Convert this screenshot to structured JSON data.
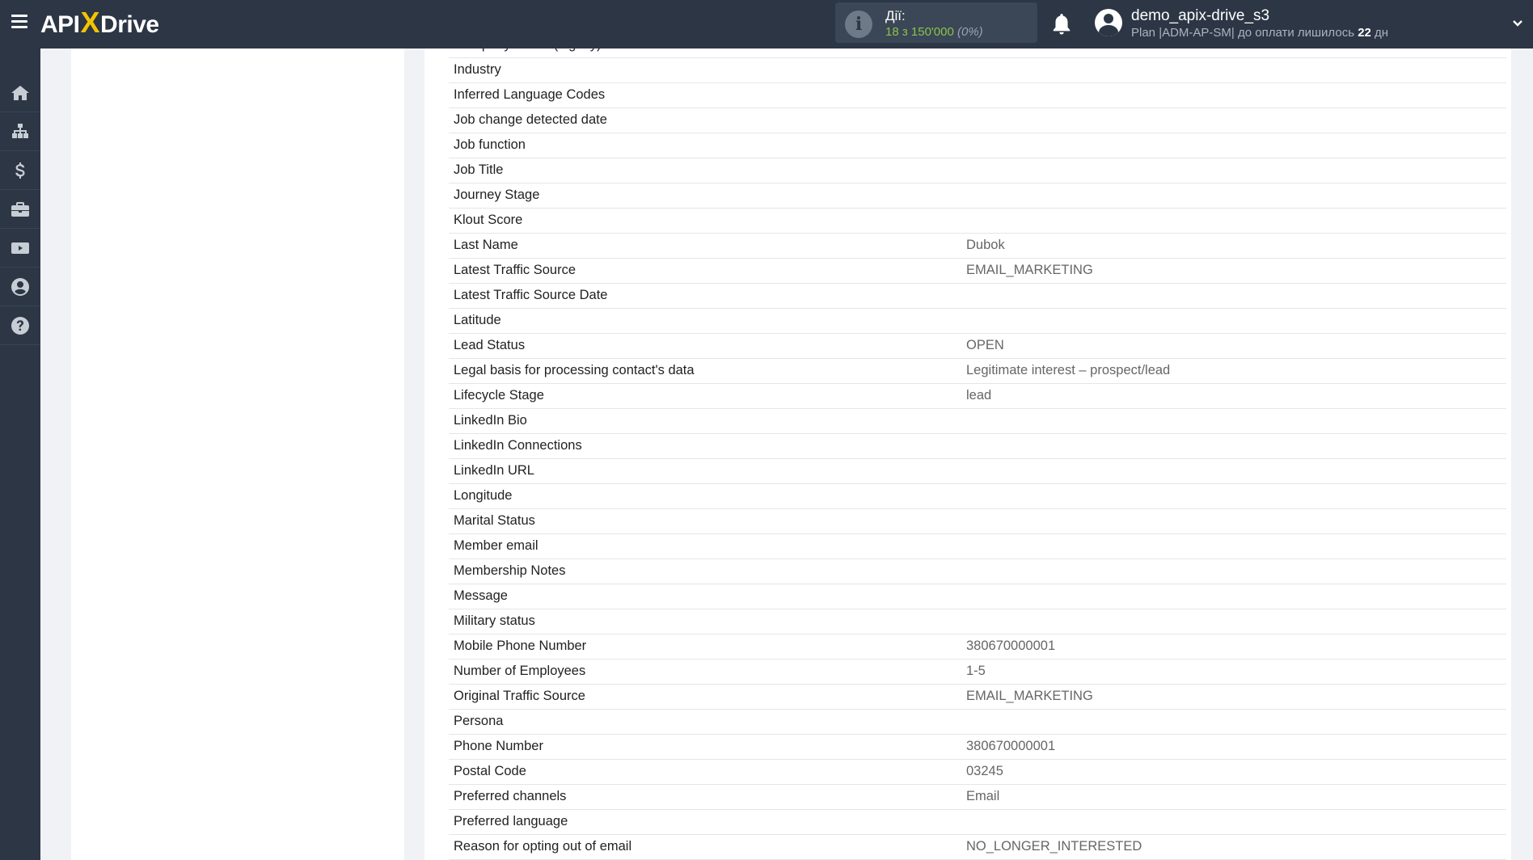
{
  "header": {
    "logo_left": "API",
    "logo_x": "X",
    "logo_right": "Drive",
    "actions_label": "Дії:",
    "actions_value": "18 з 150'000",
    "actions_percent": "(0%)",
    "user_name": "demo_apix-drive_s3",
    "plan_text": "Plan |ADM-AP-SM| до оплати лишилось",
    "days_count": "22",
    "days_unit": "дн"
  },
  "sidebar": {
    "items": [
      "home-icon",
      "sitemap-icon",
      "dollar-icon",
      "briefcase-icon",
      "youtube-icon",
      "user-circle-icon",
      "question-circle-icon"
    ]
  },
  "fields": [
    {
      "key": "Company Name (legacy)",
      "value": ""
    },
    {
      "key": "Industry",
      "value": ""
    },
    {
      "key": "Inferred Language Codes",
      "value": ""
    },
    {
      "key": "Job change detected date",
      "value": ""
    },
    {
      "key": "Job function",
      "value": ""
    },
    {
      "key": "Job Title",
      "value": ""
    },
    {
      "key": "Journey Stage",
      "value": ""
    },
    {
      "key": "Klout Score",
      "value": ""
    },
    {
      "key": "Last Name",
      "value": "Dubok"
    },
    {
      "key": "Latest Traffic Source",
      "value": "EMAIL_MARKETING"
    },
    {
      "key": "Latest Traffic Source Date",
      "value": ""
    },
    {
      "key": "Latitude",
      "value": ""
    },
    {
      "key": "Lead Status",
      "value": "OPEN"
    },
    {
      "key": "Legal basis for processing contact's data",
      "value": "Legitimate interest – prospect/lead"
    },
    {
      "key": "Lifecycle Stage",
      "value": "lead"
    },
    {
      "key": "LinkedIn Bio",
      "value": ""
    },
    {
      "key": "LinkedIn Connections",
      "value": ""
    },
    {
      "key": "LinkedIn URL",
      "value": ""
    },
    {
      "key": "Longitude",
      "value": ""
    },
    {
      "key": "Marital Status",
      "value": ""
    },
    {
      "key": "Member email",
      "value": ""
    },
    {
      "key": "Membership Notes",
      "value": ""
    },
    {
      "key": "Message",
      "value": ""
    },
    {
      "key": "Military status",
      "value": ""
    },
    {
      "key": "Mobile Phone Number",
      "value": "380670000001"
    },
    {
      "key": "Number of Employees",
      "value": "1-5"
    },
    {
      "key": "Original Traffic Source",
      "value": "EMAIL_MARKETING"
    },
    {
      "key": "Persona",
      "value": ""
    },
    {
      "key": "Phone Number",
      "value": "380670000001"
    },
    {
      "key": "Postal Code",
      "value": "03245"
    },
    {
      "key": "Preferred channels",
      "value": "Email"
    },
    {
      "key": "Preferred language",
      "value": ""
    },
    {
      "key": "Reason for opting out of email",
      "value": "NO_LONGER_INTERESTED"
    }
  ]
}
